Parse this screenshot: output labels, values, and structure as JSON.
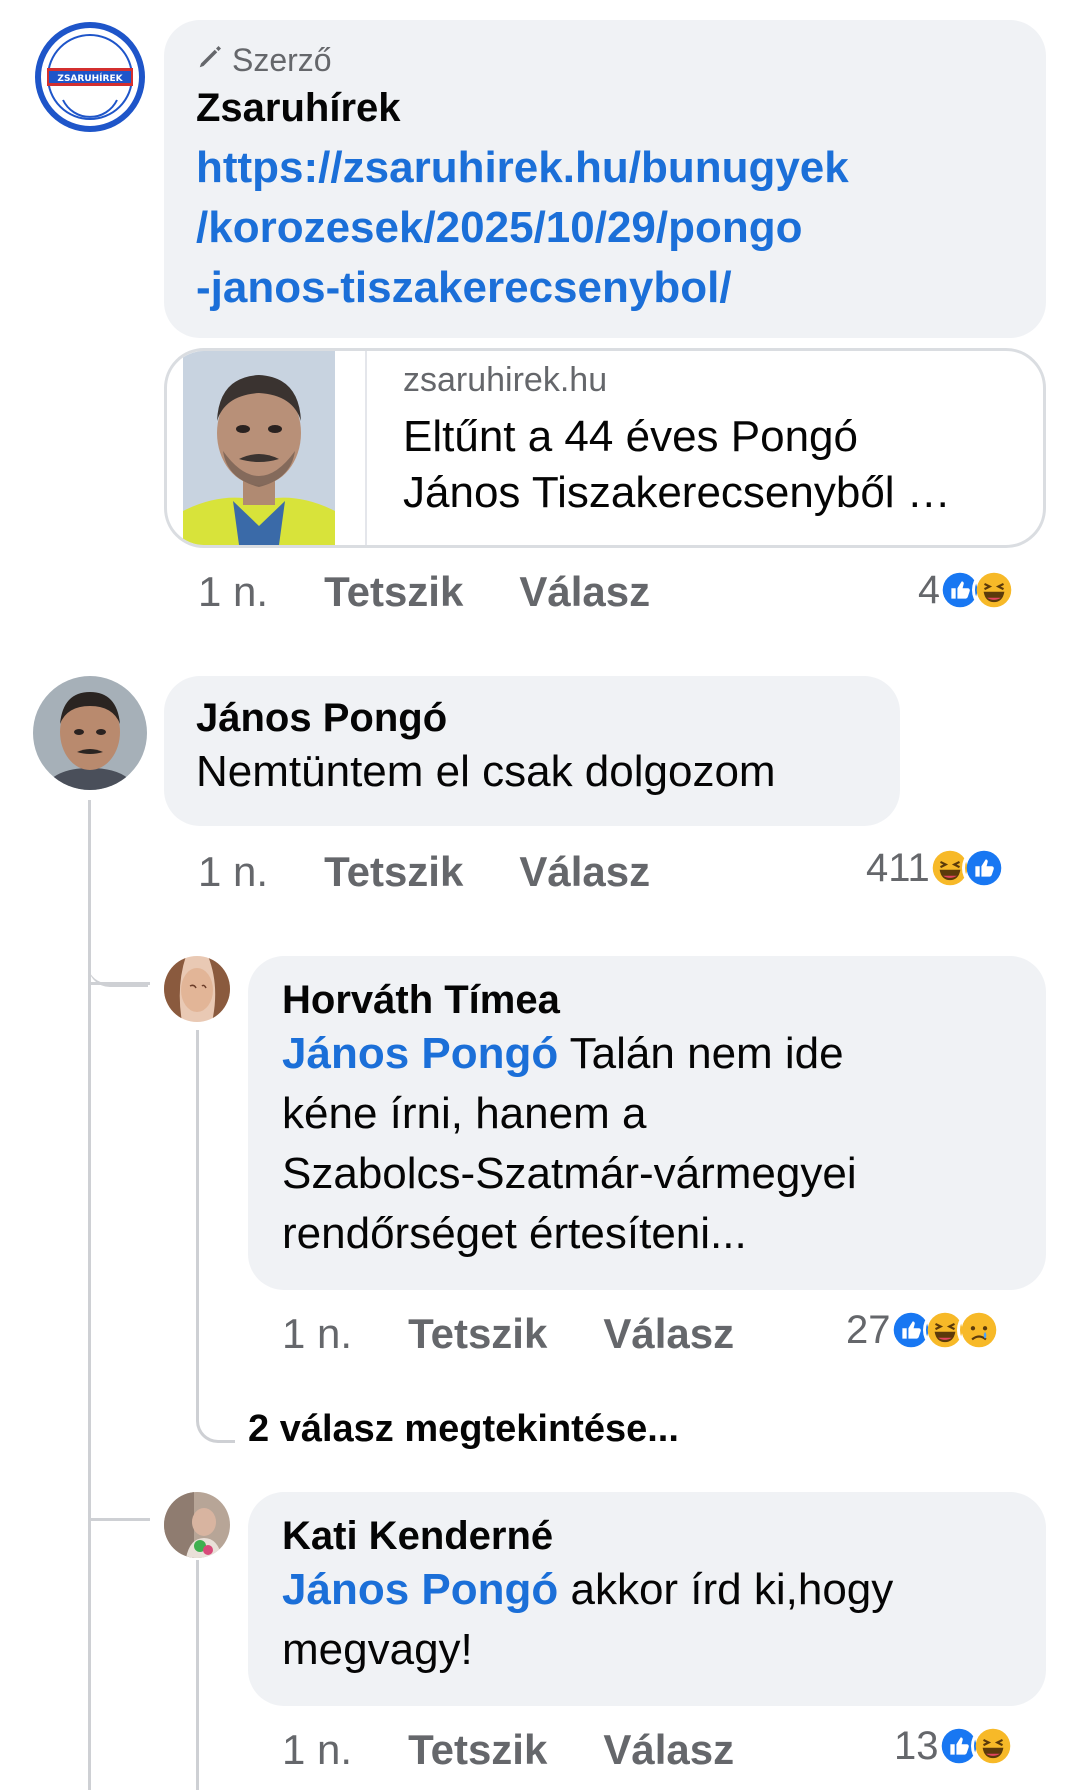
{
  "post": {
    "badge": "Szerző",
    "author": "Zsaruhírek",
    "link_lines": [
      "https://zsaruhirek.hu/bunugyek",
      "/korozesek/2025/10/29/pongo",
      "-janos-tiszakerecsenybol/"
    ],
    "preview": {
      "domain": "zsaruhirek.hu",
      "title_lines": [
        "Eltűnt a 44 éves Pongó",
        "János Tiszakerecsenyből …"
      ]
    },
    "time": "1 n.",
    "like": "Tetszik",
    "reply": "Válasz",
    "reaction_count": "4",
    "reactions": [
      "like",
      "haha"
    ]
  },
  "comments": [
    {
      "author": "János Pongó",
      "text": "Nemtüntem el csak dolgozom",
      "time": "1 n.",
      "like": "Tetszik",
      "reply": "Válasz",
      "reaction_count": "411",
      "reactions": [
        "haha",
        "like"
      ]
    }
  ],
  "replies": [
    {
      "author": "Horváth Tímea",
      "mention": "János Pongó",
      "text_lines": [
        " Talán nem ide",
        "kéne írni, hanem a",
        "Szabolcs-Szatmár-vármegyei",
        "rendőrséget értesíteni..."
      ],
      "time": "1 n.",
      "like": "Tetszik",
      "reply": "Válasz",
      "reaction_count": "27",
      "reactions": [
        "like",
        "haha",
        "sad"
      ]
    },
    {
      "author": "Kati Kenderné",
      "mention": "János Pongó",
      "text_lines": [
        " akkor írd ki,hogy",
        "megvagy!"
      ],
      "time": "1 n.",
      "like": "Tetszik",
      "reply": "Válasz",
      "reaction_count": "13",
      "reactions": [
        "like",
        "haha"
      ]
    }
  ],
  "view_more": "2 válasz megtekintése...",
  "colors": {
    "link": "#1b6fd8",
    "bubble": "#f0f2f5",
    "muted": "#65676b",
    "like_blue": "#1877f2",
    "haha_yellow": "#f7b928"
  }
}
